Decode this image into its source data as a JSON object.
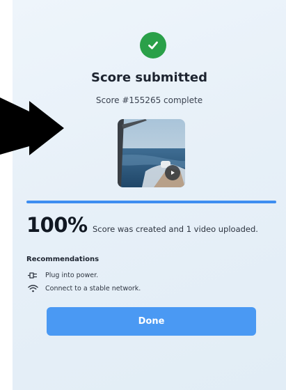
{
  "dialog": {
    "title": "Score submitted",
    "subtitle": "Score #155265 complete",
    "progress_percent": 100,
    "percent_label": "100%",
    "status_text": "Score was created and 1 video uploaded.",
    "success_icon": "check-circle-icon",
    "thumbnail": {
      "kind": "video",
      "play_icon": "play-icon"
    }
  },
  "recommendations": {
    "heading": "Recommendations",
    "items": [
      {
        "icon": "power-plug-icon",
        "label": "Plug into power."
      },
      {
        "icon": "wifi-icon",
        "label": "Connect to a stable network."
      }
    ]
  },
  "actions": {
    "done_label": "Done"
  },
  "colors": {
    "success": "#2aa049",
    "accent": "#4a99f3",
    "progress": "#3e8ef0",
    "panel_background": "#e7f0f8",
    "arrow_overlay": "#000000"
  }
}
